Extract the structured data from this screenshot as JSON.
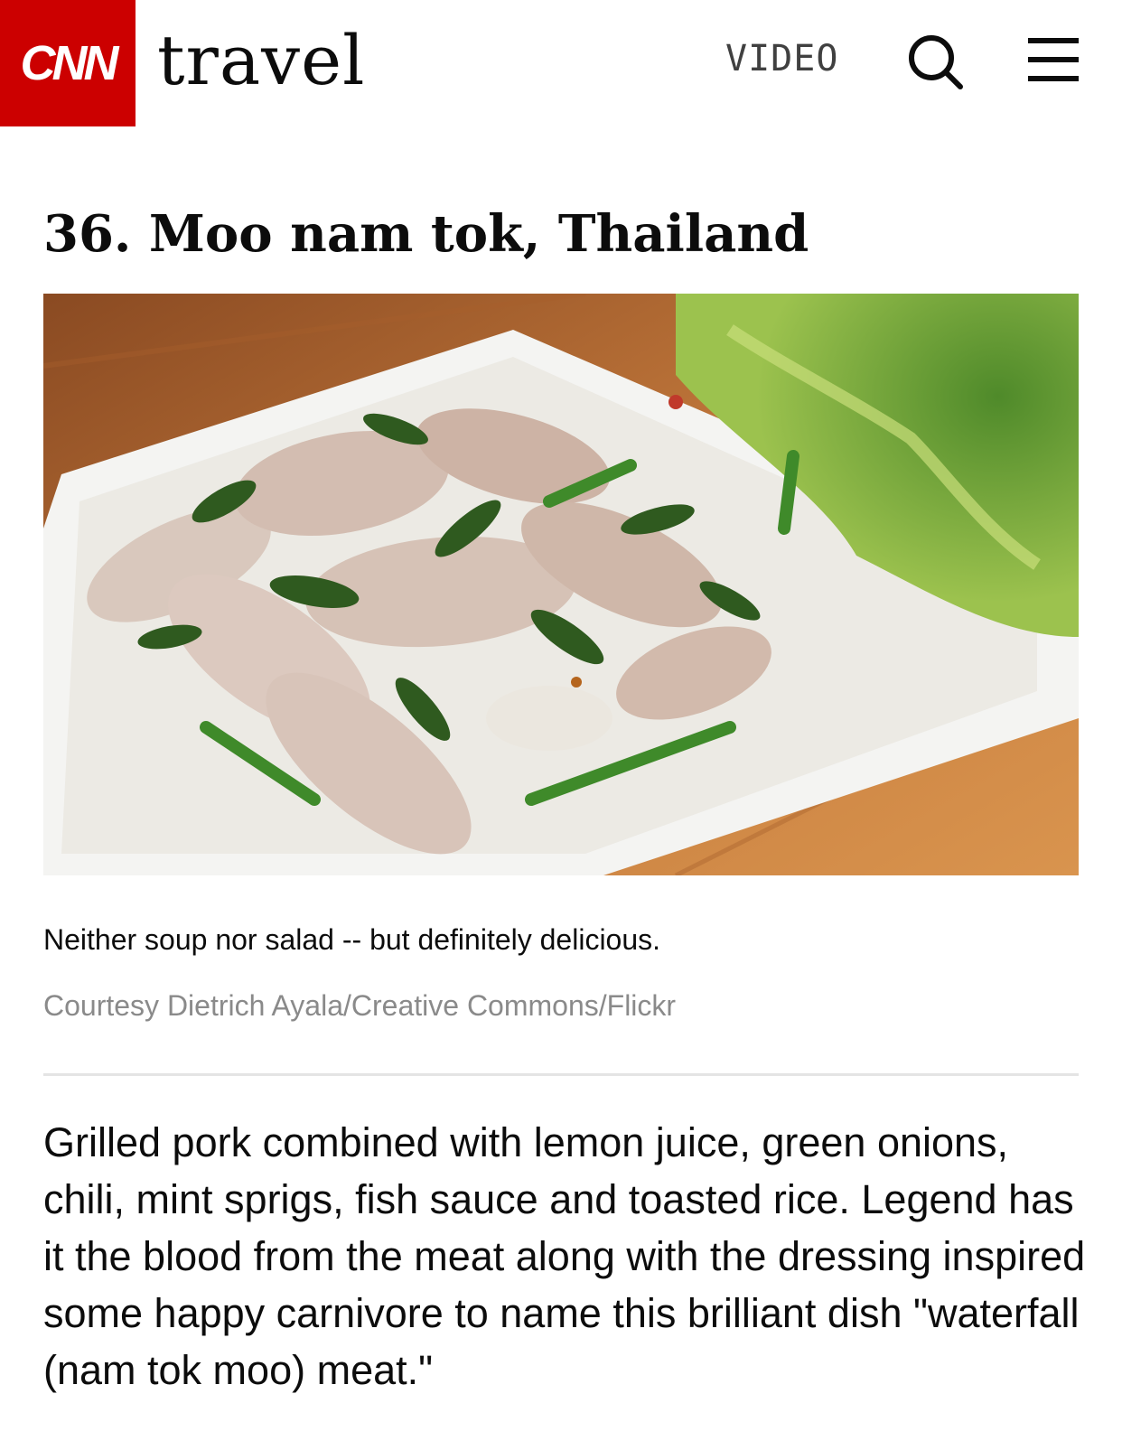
{
  "header": {
    "logo_text": "CNN",
    "section": "travel",
    "nav_video": "VIDEO",
    "search_icon": "search-icon",
    "menu_icon": "hamburger-menu-icon",
    "brand_color": "#cc0000"
  },
  "article": {
    "title": "36. Moo nam tok, Thailand",
    "image_caption": "Neither soup nor salad -- but definitely delicious.",
    "image_credit": "Courtesy Dietrich Ayala/Creative Commons/Flickr",
    "body": "Grilled pork combined with lemon juice, green onions, chili, mint sprigs, fish sauce and toasted rice. Legend has it the blood from the meat along with the dressing inspired some happy carnivore to name this brilliant dish \"waterfall (nam tok moo) meat.\""
  }
}
